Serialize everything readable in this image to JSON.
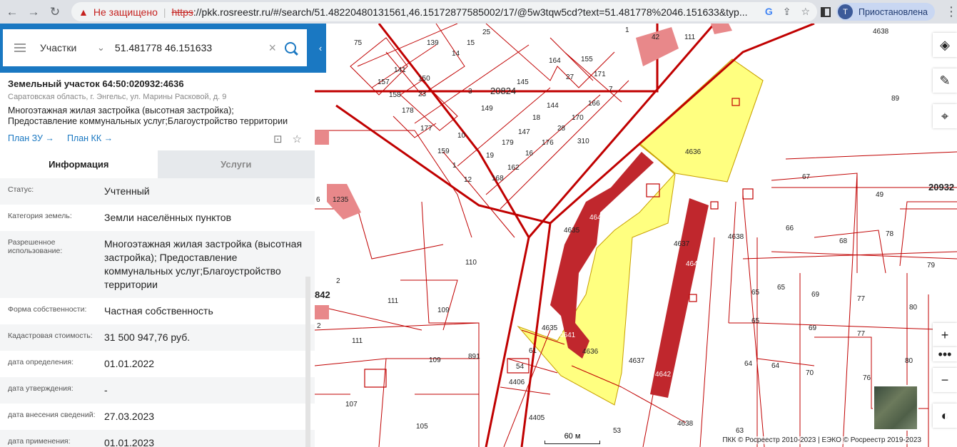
{
  "browser": {
    "insecure_label": "Не защищено",
    "url_scheme": "https",
    "url_rest": "://pkk.rosreestr.ru/#/search/51.48220480131561,46.15172877585002/17/@5w3tqw5cd?text=51.481778%2046.151633&typ...",
    "profile_initial": "Т",
    "profile_label": "Приостановлена"
  },
  "search": {
    "type_label": "Участки",
    "query": "51.481778 46.151633"
  },
  "parcel": {
    "title": "Земельный участок 64:50:020932:4636",
    "address": "Саратовская область, г. Энгельс, ул. Марины Расковой, д. 9",
    "use_line1": "Многоэтажная жилая застройка (высотная застройка);",
    "use_line2": "Предоставление коммунальных услуг;Благоустройство территории",
    "plan_zu": "План ЗУ →",
    "plan_kk": "План КК →"
  },
  "tabs": {
    "info": "Информация",
    "services": "Услуги"
  },
  "rows": [
    {
      "key": "Статус:",
      "value": "Учтенный"
    },
    {
      "key": "Категория земель:",
      "value": "Земли населённых пунктов"
    },
    {
      "key": "Разрешенное использование:",
      "value": "Многоэтажная жилая застройка (высотная застройка); Предоставление коммунальных услуг;Благоустройство территории"
    },
    {
      "key": "Форма собственности:",
      "value": "Частная собственность"
    },
    {
      "key": "Кадастровая стоимость:",
      "value": "31 500 947,76 руб."
    },
    {
      "key": "дата определения:",
      "value": "01.01.2022"
    },
    {
      "key": "дата утверждения:",
      "value": "-"
    },
    {
      "key": "дата внесения сведений:",
      "value": "27.03.2023"
    },
    {
      "key": "дата применения:",
      "value": "01.01.2023"
    }
  ],
  "map": {
    "labels": [
      "4636",
      "4636",
      "4635",
      "4635",
      "4637",
      "4637",
      "4638",
      "4638",
      "4638",
      "20824",
      "20932",
      "1235",
      "842",
      "75",
      "139",
      "14",
      "15",
      "25",
      "1",
      "42",
      "111",
      "157",
      "141",
      "150",
      "23",
      "158",
      "178",
      "3",
      "149",
      "145",
      "164",
      "155",
      "27",
      "171",
      "7",
      "166",
      "170",
      "144",
      "28",
      "18",
      "147",
      "176",
      "16",
      "179",
      "19",
      "162",
      "168",
      "12",
      "1",
      "159",
      "10",
      "177",
      "310",
      "110",
      "109",
      "109",
      "111",
      "111",
      "107",
      "105",
      "53",
      "61",
      "54",
      "4406",
      "4405",
      "891",
      "67",
      "66",
      "68",
      "78",
      "79",
      "49",
      "65",
      "65",
      "65",
      "64",
      "64",
      "69",
      "69",
      "70",
      "77",
      "77",
      "80",
      "80",
      "76",
      "89",
      "63",
      "2",
      "2",
      "6",
      "4641",
      "4641",
      "4642",
      "4642"
    ],
    "scale_label": "60 м",
    "attribution": "ПКК © Росреестр 2010-2023 | ЕЭКО © Росреестр 2019-2023"
  },
  "colors": {
    "accent": "#1a78c2",
    "parcel_line": "#c00000",
    "selected_fill": "#ffff80",
    "building": "#c0272d"
  }
}
